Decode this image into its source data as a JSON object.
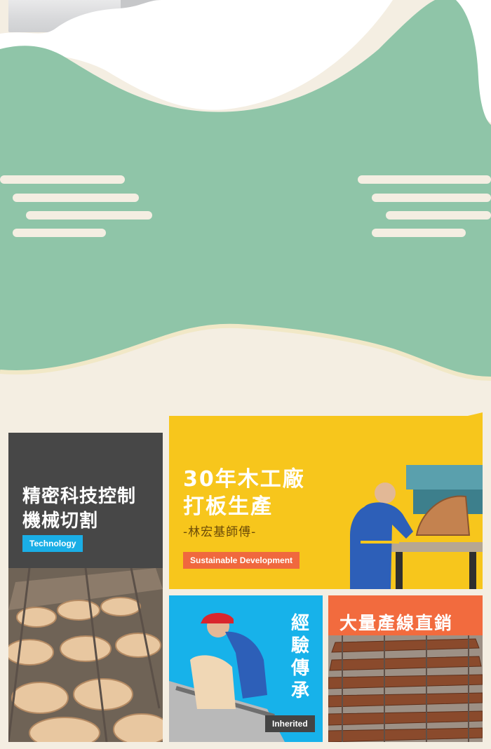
{
  "colors": {
    "mint": "#8fc5a8",
    "cream": "#f4eee2",
    "yellow": "#f7c61c",
    "dark_gray": "#474747",
    "sky_blue": "#17b2ea",
    "orange": "#f26b3e"
  },
  "technology_panel": {
    "title": "精密科技控制\n機械切割",
    "tag": "Technology",
    "image": "bent-plywood-seat-parts-on-conveyor"
  },
  "factory_panel": {
    "title": "30年木工廠\n打板生產",
    "subtitle": "-林宏基師傅-",
    "tag": "Sustainable Development",
    "image": "craftsman-at-woodworking-machine"
  },
  "inheritance_panel": {
    "title": "經\n驗\n傳\n承",
    "tag": "Inherited",
    "image": "worker-in-red-cap-sanding-wood"
  },
  "production_panel": {
    "title": "大量產線直銷",
    "image": "stacked-plywood-chair-seats"
  }
}
